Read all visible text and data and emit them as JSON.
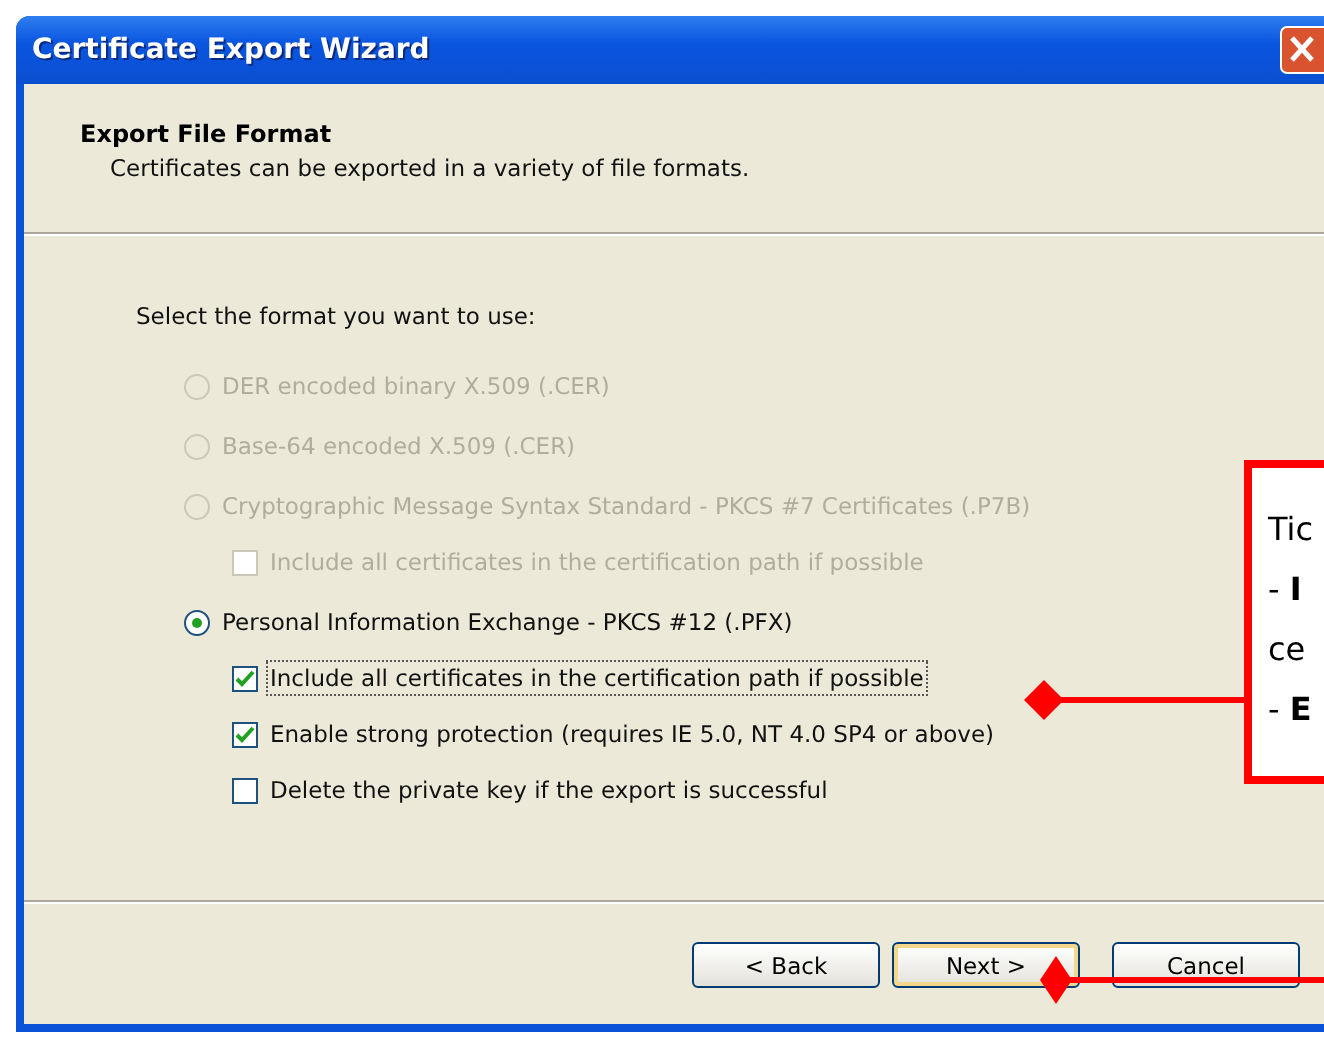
{
  "window": {
    "title": "Certificate Export Wizard"
  },
  "header": {
    "title": "Export File Format",
    "subtitle": "Certificates can be exported in a variety of file formats."
  },
  "prompt": "Select the format you want to use:",
  "options": [
    {
      "kind": "radio",
      "label": "DER encoded binary X.509 (.CER)",
      "selected": false,
      "disabled": true
    },
    {
      "kind": "radio",
      "label": "Base-64 encoded X.509 (.CER)",
      "selected": false,
      "disabled": true
    },
    {
      "kind": "radio",
      "label": "Cryptographic Message Syntax Standard - PKCS #7 Certificates (.P7B)",
      "selected": false,
      "disabled": true,
      "children": [
        {
          "kind": "checkbox",
          "label": "Include all certificates in the certification path if possible",
          "checked": false,
          "disabled": true,
          "focused": false
        }
      ]
    },
    {
      "kind": "radio",
      "label": "Personal Information Exchange - PKCS #12 (.PFX)",
      "selected": true,
      "disabled": false,
      "children": [
        {
          "kind": "checkbox",
          "label": "Include all certificates in the certification path if possible",
          "checked": true,
          "disabled": false,
          "focused": true
        },
        {
          "kind": "checkbox",
          "label": "Enable strong protection (requires IE 5.0, NT 4.0 SP4 or above)",
          "checked": true,
          "disabled": false,
          "focused": false
        },
        {
          "kind": "checkbox",
          "label": "Delete the private key if the export is successful",
          "checked": false,
          "disabled": false,
          "focused": false
        }
      ]
    }
  ],
  "buttons": [
    {
      "label": "< Back",
      "default": false
    },
    {
      "label": "Next >",
      "default": true
    },
    {
      "label": "Cancel",
      "default": false
    }
  ],
  "callout": {
    "lines": [
      "Tic",
      "- **I**",
      "ce",
      "- **E**"
    ]
  }
}
